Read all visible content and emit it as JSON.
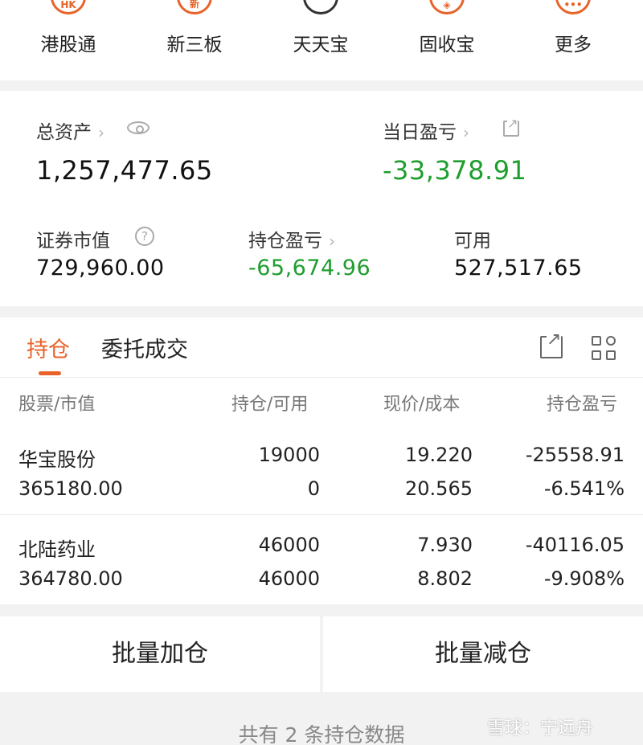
{
  "shortcuts": [
    {
      "label": "港股通",
      "icon": "hk-icon",
      "icon_text": "HK"
    },
    {
      "label": "新三板",
      "icon": "new-board-icon",
      "icon_text": "新"
    },
    {
      "label": "天天宝",
      "icon": "piggy-bank-icon",
      "icon_text": ""
    },
    {
      "label": "固收宝",
      "icon": "fixed-income-icon",
      "icon_text": "◈"
    },
    {
      "label": "更多",
      "icon": "more-icon",
      "icon_text": "•••"
    }
  ],
  "assets": {
    "total_label": "总资产",
    "total_value": "1,257,477.65",
    "daily_pl_label": "当日盈亏",
    "daily_pl_value": "-33,378.91",
    "market_value_label": "证券市值",
    "market_value": "729,960.00",
    "position_pl_label": "持仓盈亏",
    "position_pl_value": "-65,674.96",
    "available_label": "可用",
    "available_value": "527,517.65"
  },
  "holdings": {
    "tabs": [
      "持仓",
      "委托成交"
    ],
    "active_tab": 0,
    "headers": [
      "股票/市值",
      "持仓/可用",
      "现价/成本",
      "持仓盈亏"
    ],
    "rows": [
      {
        "name": "华宝股份",
        "market_value": "365180.00",
        "position": "19000",
        "available": "0",
        "price": "19.220",
        "cost": "20.565",
        "pl": "-25558.91",
        "pl_pct": "-6.541%"
      },
      {
        "name": "北陆药业",
        "market_value": "364780.00",
        "position": "46000",
        "available": "46000",
        "price": "7.930",
        "cost": "8.802",
        "pl": "-40116.05",
        "pl_pct": "-9.908%"
      }
    ]
  },
  "actions": {
    "batch_add": "批量加仓",
    "batch_reduce": "批量减仓"
  },
  "footer": {
    "summary": "共有 2 条持仓数据"
  },
  "watermark": "雪球：宁远舟",
  "colors": {
    "accent": "#e8632a",
    "loss": "#1e9e2e"
  }
}
